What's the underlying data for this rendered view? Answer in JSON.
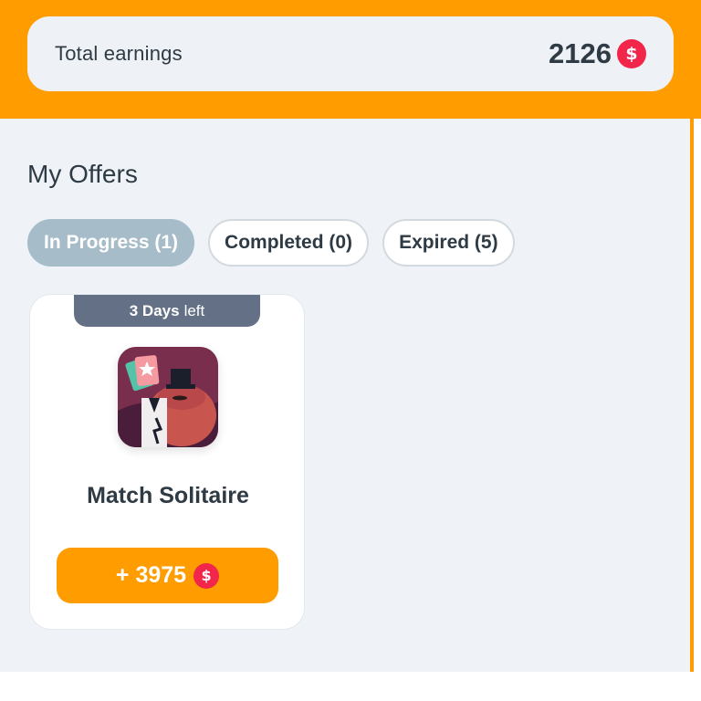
{
  "earnings": {
    "label": "Total earnings",
    "value": "2126",
    "currency_symbol": "$"
  },
  "offers": {
    "title": "My Offers",
    "tabs": [
      {
        "label": "In Progress (1)",
        "active": true
      },
      {
        "label": "Completed (0)",
        "active": false
      },
      {
        "label": "Expired (5)",
        "active": false
      }
    ],
    "items": [
      {
        "time_left_value": "3 Days",
        "time_left_suffix": "left",
        "title": "Match Solitaire",
        "reward_label": "+ 3975",
        "reward_currency_symbol": "$",
        "icon": "match-solitaire-app-icon"
      }
    ]
  },
  "colors": {
    "brand_orange": "#FF9C00",
    "coin_red": "#F2264B",
    "active_tab": "#A6BCC8",
    "days_tag": "#637085",
    "text_dark": "#2E3A44",
    "background": "#EFF3F7"
  }
}
